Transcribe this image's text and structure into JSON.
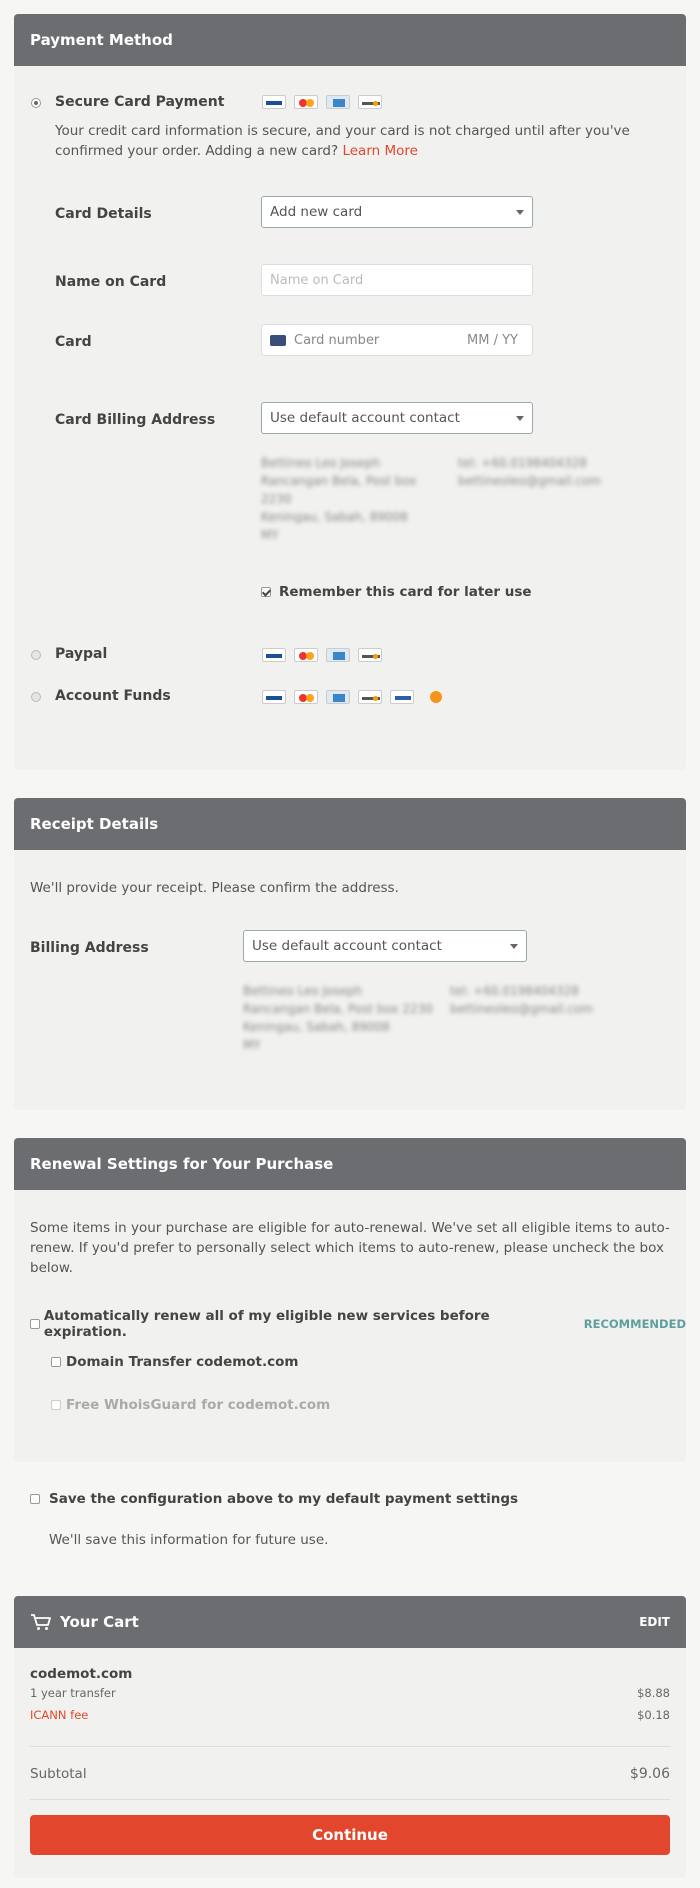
{
  "payment": {
    "title": "Payment Method",
    "secure": {
      "label": "Secure Card Payment",
      "info": "Your credit card information is secure, and your card is not charged until after you've confirmed your order. Adding a new card?",
      "learn_more": "Learn More",
      "cards": [
        "visa-icon",
        "mastercard-icon",
        "amex-icon",
        "discover-icon"
      ]
    },
    "card_details": {
      "label": "Card Details",
      "value": "Add new card"
    },
    "name_on_card": {
      "label": "Name on Card",
      "placeholder": "Name on Card"
    },
    "card": {
      "label": "Card",
      "number_placeholder": "Card number",
      "expiry_placeholder": "MM / YY"
    },
    "billing": {
      "label": "Card Billing Address",
      "value": "Use default account contact",
      "address": [
        "Bettineo Leo Joseph",
        "Rancangan Bela, Post box",
        "2230",
        "Keningau, Sabah, 89008",
        "MY"
      ],
      "contact": [
        "tel: +60.0198404328",
        "bettineoleo@gmail.com"
      ]
    },
    "remember": "Remember this card for later use",
    "paypal": {
      "label": "Paypal"
    },
    "funds": {
      "label": "Account Funds"
    }
  },
  "receipt": {
    "title": "Receipt Details",
    "intro": "We'll provide your receipt. Please confirm the address.",
    "billing_label": "Billing Address",
    "billing_value": "Use default account contact",
    "address": [
      "Bettineo Leo Joseph",
      "Rancangan Bela, Post box 2230",
      "Keningau, Sabah, 89008",
      "MY"
    ],
    "contact": [
      "tel: +60.0198404328",
      "bettineoleo@gmail.com"
    ]
  },
  "renewal": {
    "title": "Renewal Settings for Your Purchase",
    "intro": "Some items in your purchase are eligible for auto-renewal. We've set all eligible items to auto-renew. If you'd prefer to personally select which items to auto-renew, please uncheck the box below.",
    "auto_label": "Automatically renew all of my eligible new services before expiration.",
    "recommended": "RECOMMENDED",
    "item1": "Domain Transfer codemot.com",
    "item2": "Free WhoisGuard for codemot.com"
  },
  "save": {
    "label": "Save the configuration above to my default payment settings",
    "note": "We'll save this information for future use."
  },
  "cart": {
    "title": "Your Cart",
    "edit": "EDIT",
    "domain": "codemot.com",
    "line1_label": "1 year transfer",
    "line1_price": "$8.88",
    "line2_label": "ICANN fee",
    "line2_price": "$0.18",
    "subtotal_label": "Subtotal",
    "subtotal_value": "$9.06",
    "continue": "Continue"
  },
  "colors": {
    "header": "#6c6d71",
    "accent": "#e2472e",
    "recommended": "#5f9ea0"
  }
}
